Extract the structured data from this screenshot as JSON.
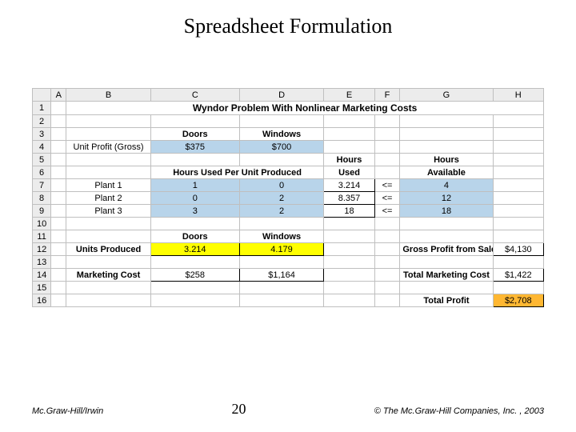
{
  "title": "Spreadsheet Formulation",
  "columns": [
    "A",
    "B",
    "C",
    "D",
    "E",
    "F",
    "G",
    "H"
  ],
  "rows_label_count": 16,
  "sheet_title": "Wyndor Problem With Nonlinear Marketing Costs",
  "labels": {
    "doors": "Doors",
    "windows": "Windows",
    "unit_profit": "Unit Profit (Gross)",
    "hours_used_per_unit": "Hours Used Per Unit Produced",
    "hours_used": "Hours Used",
    "hours_available": "Hours Available",
    "plant1": "Plant 1",
    "plant2": "Plant 2",
    "plant3": "Plant 3",
    "units_produced": "Units Produced",
    "gross_profit": "Gross Profit from Sales",
    "marketing_cost": "Marketing Cost",
    "total_marketing_cost": "Total Marketing Cost",
    "total_profit": "Total Profit",
    "leq": "<="
  },
  "values": {
    "unit_profit_doors": "$375",
    "unit_profit_windows": "$700",
    "p1_doors": "1",
    "p1_windows": "0",
    "p1_used": "3.214",
    "p1_avail": "4",
    "p2_doors": "0",
    "p2_windows": "2",
    "p2_used": "8.357",
    "p2_avail": "12",
    "p3_doors": "3",
    "p3_windows": "2",
    "p3_used": "18",
    "p3_avail": "18",
    "units_doors": "3.214",
    "units_windows": "4.179",
    "gross_profit_value": "$4,130",
    "mkt_doors": "$258",
    "mkt_windows": "$1,164",
    "total_mkt": "$1,422",
    "total_profit_value": "$2,708"
  },
  "footer": {
    "left": "Mc.Graw-Hill/Irwin",
    "center": "20",
    "right": "© The Mc.Graw-Hill Companies, Inc. , 2003"
  },
  "chart_data": {
    "type": "table",
    "title": "Wyndor Problem With Nonlinear Marketing Costs",
    "products": [
      "Doors",
      "Windows"
    ],
    "unit_profit_gross": {
      "Doors": 375,
      "Windows": 700
    },
    "hours_per_unit": {
      "Plant 1": {
        "Doors": 1,
        "Windows": 0
      },
      "Plant 2": {
        "Doors": 0,
        "Windows": 2
      },
      "Plant 3": {
        "Doors": 3,
        "Windows": 2
      }
    },
    "hours_used": {
      "Plant 1": 3.214,
      "Plant 2": 8.357,
      "Plant 3": 18
    },
    "hours_available": {
      "Plant 1": 4,
      "Plant 2": 12,
      "Plant 3": 18
    },
    "constraint_relation": "<=",
    "units_produced": {
      "Doors": 3.214,
      "Windows": 4.179
    },
    "gross_profit_from_sales": 4130,
    "marketing_cost": {
      "Doors": 258,
      "Windows": 1164
    },
    "total_marketing_cost": 1422,
    "total_profit": 2708
  }
}
